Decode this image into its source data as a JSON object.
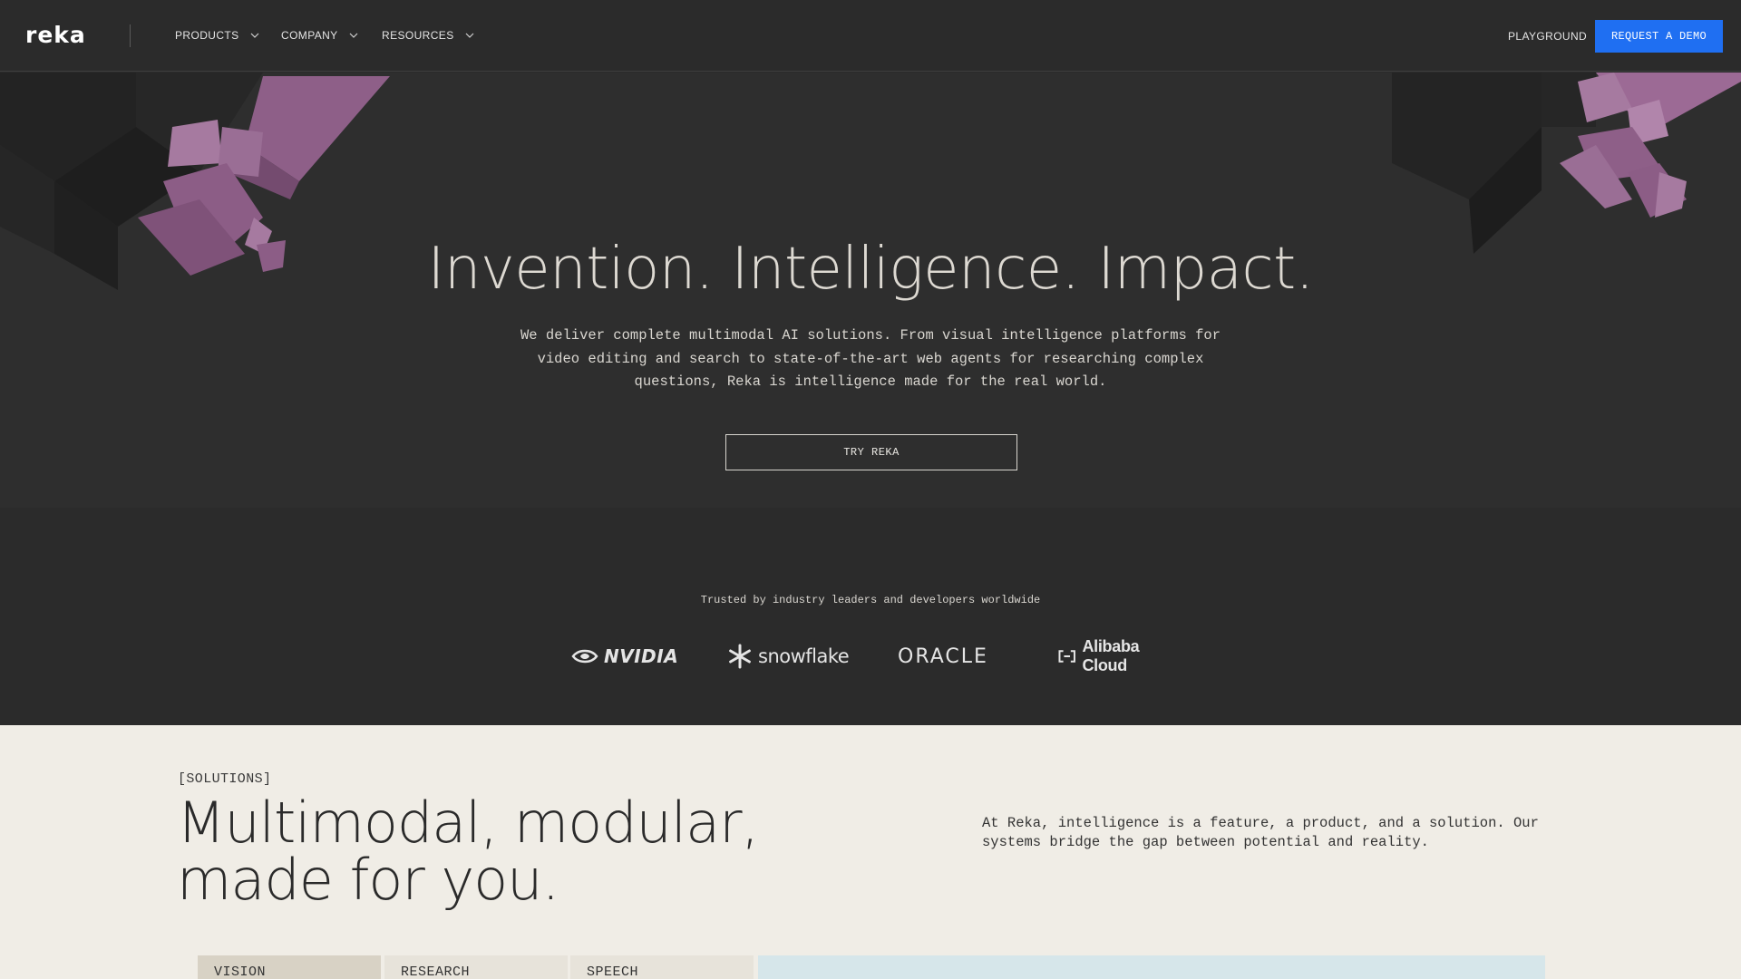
{
  "nav": {
    "logo_text": "reka",
    "items": [
      {
        "label": "PRODUCTS"
      },
      {
        "label": "COMPANY"
      },
      {
        "label": "RESOURCES"
      }
    ],
    "playground": "PLAYGROUND",
    "cta": "REQUEST A DEMO"
  },
  "hero": {
    "title": "Invention. Intelligence. Impact.",
    "subtitle": "We deliver complete multimodal AI solutions. From visual intelligence platforms for video editing and search to state-of-the-art web agents for researching complex questions, Reka is intelligence made for the real world.",
    "cta": "TRY REKA",
    "trusted": "Trusted by industry leaders and developers worldwide",
    "partners": [
      "NVIDIA",
      "snowflake",
      "ORACLE",
      "Alibaba Cloud"
    ]
  },
  "solutions": {
    "tag": "[SOLUTIONS]",
    "title_line1": "Multimodal, modular,",
    "title_line2": "made for you.",
    "description": "At Reka, intelligence is a feature, a product, and a solution. Our systems bridge the gap between potential and reality.",
    "tabs": [
      "VISION",
      "RESEARCH",
      "SPEECH"
    ]
  },
  "colors": {
    "background": "#2b2b2b",
    "accent": "#1f6ff2",
    "cube_purple": "#9c6a95",
    "solutions_bg": "#f0ede6"
  }
}
